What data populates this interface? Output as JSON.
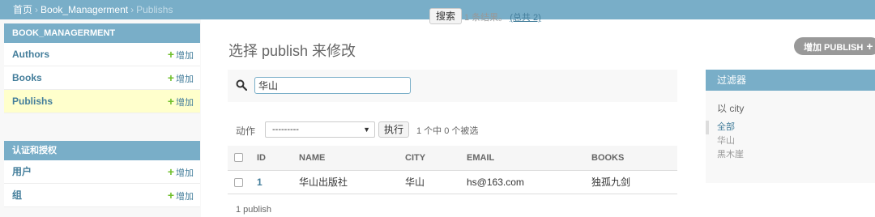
{
  "breadcrumbs": {
    "home": "首页",
    "app": "Book_Managerment",
    "current": "Publishs"
  },
  "sidebar": {
    "app_caption": "BOOK_MANAGERMENT",
    "models": [
      {
        "name": "Authors",
        "add": "增加",
        "active": false
      },
      {
        "name": "Books",
        "add": "增加",
        "active": false
      },
      {
        "name": "Publishs",
        "add": "增加",
        "active": true
      }
    ],
    "auth_caption": "认证和授权",
    "auth_models": [
      {
        "name": "用户",
        "add": "增加"
      },
      {
        "name": "组",
        "add": "增加"
      }
    ]
  },
  "main": {
    "title": "选择 publish 来修改",
    "add_button": "增加 PUBLISH"
  },
  "search": {
    "value": "华山",
    "button": "搜索",
    "result_count": "1 条结果。",
    "total": "(总共 2)"
  },
  "actions": {
    "label": "动作",
    "selected": "---------",
    "go": "执行",
    "counter": "1 个中 0 个被选"
  },
  "table": {
    "columns": [
      "ID",
      "NAME",
      "CITY",
      "EMAIL",
      "BOOKS"
    ],
    "rows": [
      [
        "1",
        "华山出版社",
        "华山",
        "hs@163.com",
        "独孤九剑"
      ]
    ]
  },
  "paginator": "1 publish",
  "filter": {
    "caption": "过滤器",
    "by": "以 city",
    "options": [
      "全部",
      "华山",
      "黑木崖"
    ],
    "selected_index": 0
  },
  "colors": {
    "header": "#79aec8",
    "link": "#447e9b",
    "active_row": "#ffffcc",
    "addlink_plus": "#70bf2b"
  }
}
